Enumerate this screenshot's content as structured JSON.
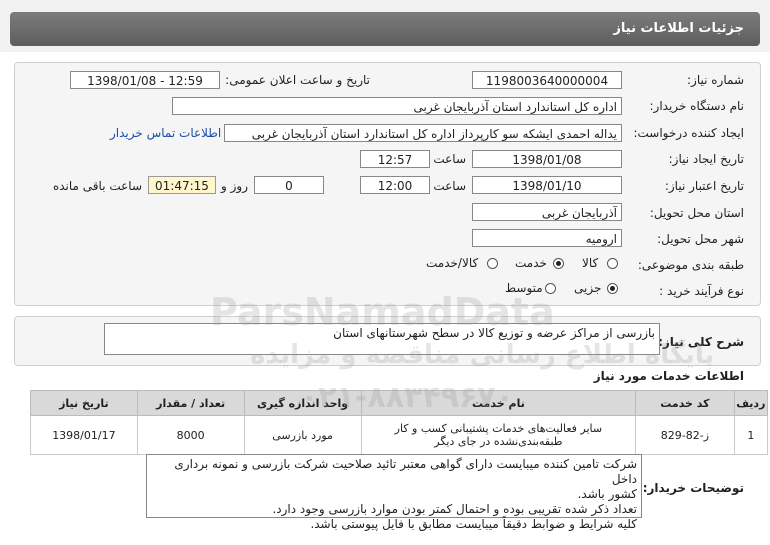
{
  "page_title": "جزئیات اطلاعات نیاز",
  "fields": {
    "need_number_label": "شماره نیاز:",
    "need_number": "1198003640000004",
    "announce_label": "تاریخ و ساعت اعلان عمومی:",
    "announce_value": "1398/01/08 - 12:59",
    "buyer_org_label": "نام دستگاه خریدار:",
    "buyer_org": "اداره کل استاندارد استان آذربایجان غربی",
    "requester_label": "ایجاد کننده درخواست:",
    "requester": "یداله  احمدی ایشکه سو کارپرداز اداره کل استاندارد استان آذربایجان غربی",
    "contact_link": "اطلاعات تماس خریدار",
    "create_date_label": "تاریخ ایجاد نیاز:",
    "create_date": "1398/01/08",
    "create_time_label": "ساعت",
    "create_time": "12:57",
    "valid_date_label": "تاریخ اعتبار نیاز:",
    "valid_date": "1398/01/10",
    "valid_time_label": "ساعت",
    "valid_time": "12:00",
    "days_value": "0",
    "days_label": "روز و",
    "remaining_time": "01:47:15",
    "remaining_label": "ساعت باقی مانده",
    "province_label": "استان محل تحویل:",
    "province": "آذربایجان غربی",
    "city_label": "شهر محل تحویل:",
    "city": "ارومیه",
    "category_label": "طبقه بندی موضوعی:",
    "category_options": [
      "کالا",
      "خدمت",
      "کالا/خدمت"
    ],
    "category_selected": "خدمت",
    "process_label": "نوع فرآیند خرید :",
    "process_options": [
      "جزیی",
      "متوسط"
    ],
    "process_selected": "جزیی"
  },
  "description": {
    "label": "شرح کلی نیاز:",
    "text": "بازرسی از مراکز عرضه و توزیع کالا در سطح شهرستانهای استان"
  },
  "services": {
    "title": "اطلاعات خدمات مورد نیاز",
    "headers": [
      "ردیف",
      "کد خدمت",
      "نام خدمت",
      "واحد اندازه گیری",
      "تعداد / مقدار",
      "تاریخ نیاز"
    ],
    "rows": [
      {
        "index": "1",
        "code": "ز-82-829",
        "name_line1": "سایر فعالیت‌های خدمات پشتیبانی کسب و کار",
        "name_line2": "طبقه‌بندی‌نشده در جای دیگر",
        "unit": "مورد بازرسی",
        "qty": "8000",
        "date": "1398/01/17"
      }
    ]
  },
  "notes": {
    "label": "توضیحات خریدار:",
    "line1": "شرکت تامین کننده میبایست دارای گواهی معتبر تائید صلاحیت شرکت بازرسی و نمونه برداری داخل",
    "line2": "کشور باشد.",
    "line3": "تعداد ذکر شده تقریبی بوده و احتمال کمتر بودن موارد بازرسی وجود دارد.",
    "line4": "کلیه شرایط و ضوابط دقیقاً میبایست مطابق با فایل پیوستی باشد."
  },
  "watermark": {
    "line1": "ParsNamadData",
    "line2": "پایگاه اطلاع رسانی مناقصه و مزایده",
    "line3": "۰۲۱-۸۸۳۴۹۶۷۰"
  }
}
